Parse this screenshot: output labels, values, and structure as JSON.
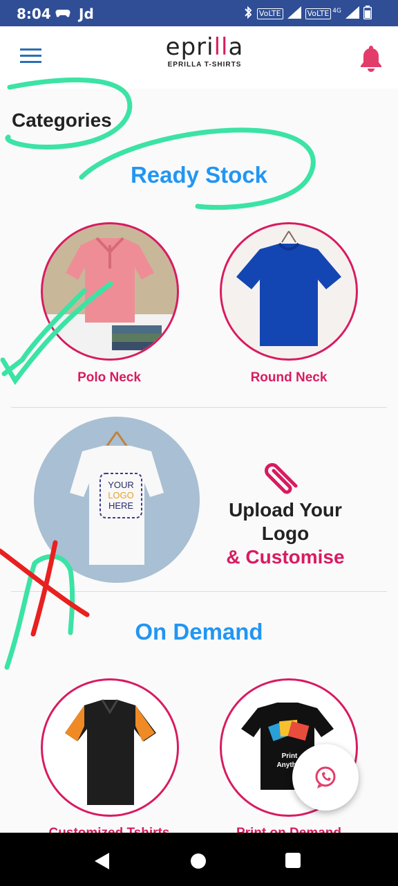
{
  "status": {
    "time": "8:04",
    "carrier": "Jd",
    "volte1": "VoLTE",
    "volte2": "VoLTE",
    "net": "4G"
  },
  "header": {
    "logo_main_left": "epri",
    "logo_main_pink": "ll",
    "logo_main_right": "a",
    "logo_sub": "EPRILLA T-SHIRTS"
  },
  "page": {
    "heading": "Categories"
  },
  "ready_stock": {
    "title": "Ready Stock",
    "items": [
      {
        "label": "Polo Neck"
      },
      {
        "label": "Round Neck"
      }
    ]
  },
  "upload": {
    "line1": "Upload Your Logo",
    "line2": "& Customise",
    "tee_text": [
      "YOUR",
      "LOGO",
      "HERE"
    ]
  },
  "on_demand": {
    "title": "On Demand",
    "items": [
      {
        "label": "Customized Tshirts"
      },
      {
        "label": "Print on Demand"
      }
    ],
    "print_text": [
      "Print",
      "Anythi"
    ]
  },
  "colors": {
    "status_bar": "#2f4e96",
    "accent_pink": "#d81b60",
    "accent_blue": "#2196f3",
    "annotation_green": "#3be3a5",
    "annotation_red": "#e8201f"
  },
  "icons": {
    "menu": "hamburger-icon",
    "notifications": "bell-icon",
    "attach": "paperclip-icon",
    "chat": "whatsapp-icon"
  }
}
